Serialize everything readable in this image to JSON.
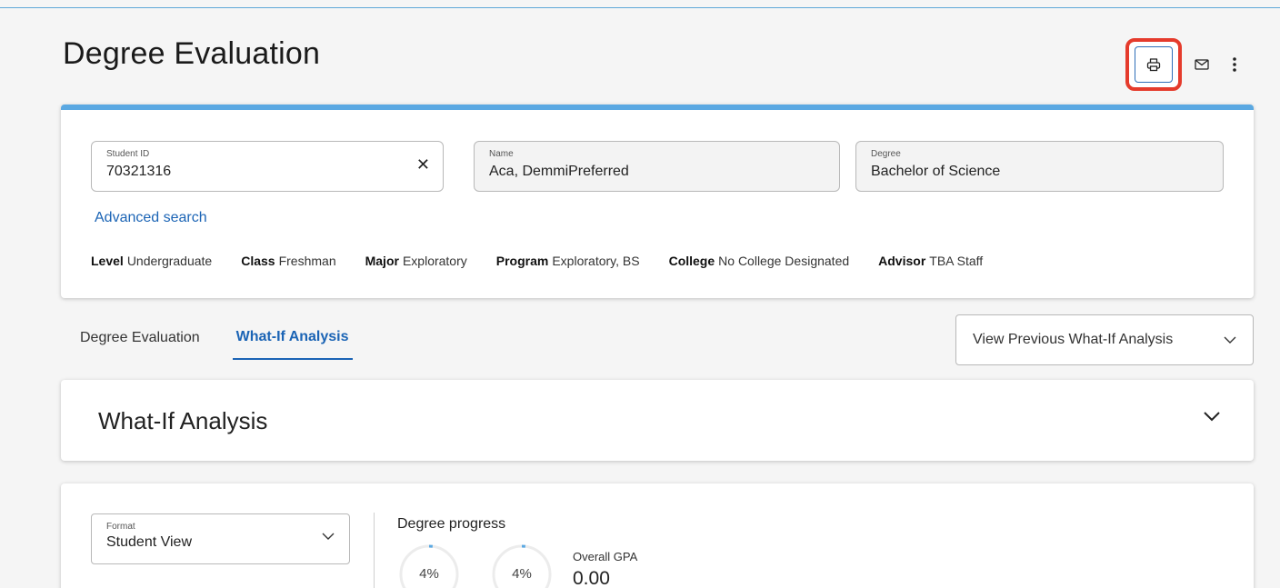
{
  "page": {
    "title": "Degree Evaluation"
  },
  "header": {
    "print_icon": "printer-icon",
    "email_icon": "envelope-icon",
    "more_icon": "vertical-dots-icon"
  },
  "search": {
    "student_id": {
      "label": "Student ID",
      "value": "70321316"
    },
    "name": {
      "label": "Name",
      "value": "Aca, DemmiPreferred"
    },
    "degree": {
      "label": "Degree",
      "value": "Bachelor of Science"
    },
    "advanced_search": "Advanced search"
  },
  "info": {
    "level": {
      "label": "Level",
      "value": "Undergraduate"
    },
    "class": {
      "label": "Class",
      "value": "Freshman"
    },
    "major": {
      "label": "Major",
      "value": "Exploratory"
    },
    "program": {
      "label": "Program",
      "value": "Exploratory, BS"
    },
    "college": {
      "label": "College",
      "value": "No College Designated"
    },
    "advisor": {
      "label": "Advisor",
      "value": "TBA Staff"
    }
  },
  "tabs": [
    {
      "label": "Degree Evaluation",
      "active": false
    },
    {
      "label": "What-If Analysis",
      "active": true
    }
  ],
  "previous_analysis": {
    "label": "View Previous What-If Analysis"
  },
  "whatif_section": {
    "title": "What-If Analysis"
  },
  "progress": {
    "format": {
      "label": "Format",
      "value": "Student View"
    },
    "title": "Degree progress",
    "rings": [
      {
        "label": "4%",
        "percent": 4
      },
      {
        "label": "4%",
        "percent": 4
      }
    ],
    "gpa_label": "Overall GPA",
    "gpa_value": "0.00"
  },
  "colors": {
    "accent": "#1b64b5",
    "card_top": "#5aa8e2",
    "highlight": "#e53b2c"
  }
}
